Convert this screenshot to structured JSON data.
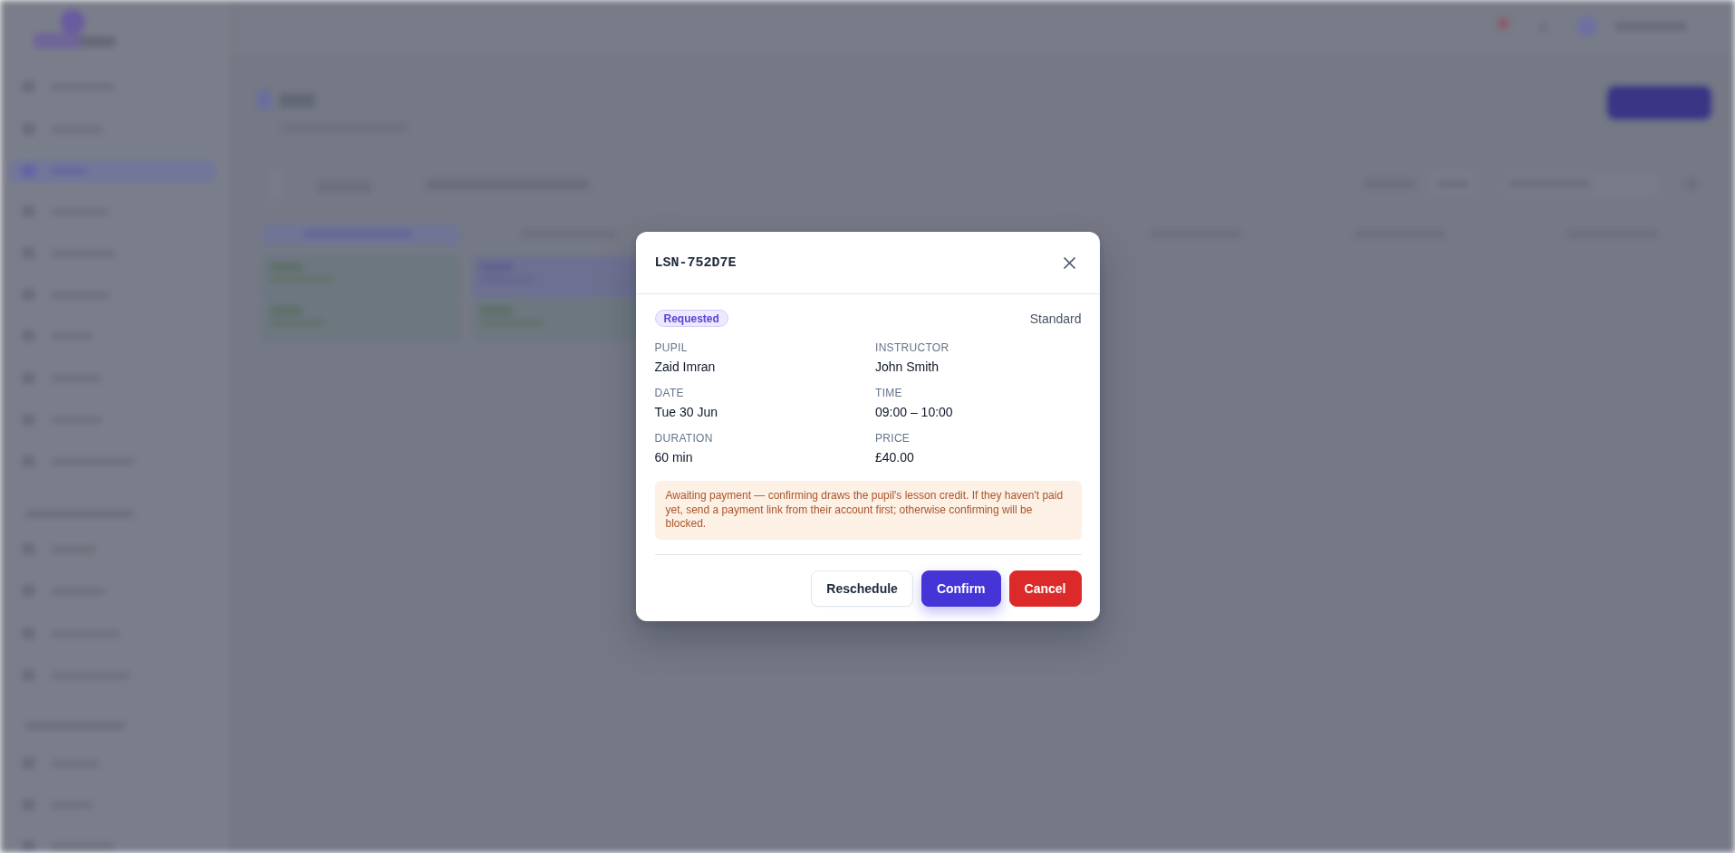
{
  "dialog": {
    "title": "LSN-752D7E",
    "status": {
      "label": "Requested",
      "kind": "requested"
    },
    "lesson_type": "Standard",
    "fields": [
      {
        "label": "PUPIL",
        "value": "Zaid Imran"
      },
      {
        "label": "INSTRUCTOR",
        "value": "John Smith"
      },
      {
        "label": "DATE",
        "value": "Tue 30 Jun"
      },
      {
        "label": "TIME",
        "value": "09:00 – 10:00"
      },
      {
        "label": "DURATION",
        "value": "60 min"
      },
      {
        "label": "PRICE",
        "value": "£40.00"
      }
    ],
    "notice": {
      "kind": "warning",
      "text": "Awaiting payment — confirming draws the pupil's lesson credit. If they haven't paid yet, send a payment link from their account first; otherwise confirming will be blocked."
    },
    "buttons": [
      {
        "label": "Reschedule",
        "kind": "secondary"
      },
      {
        "label": "Confirm",
        "kind": "primary"
      },
      {
        "label": "Cancel",
        "kind": "danger"
      }
    ]
  }
}
